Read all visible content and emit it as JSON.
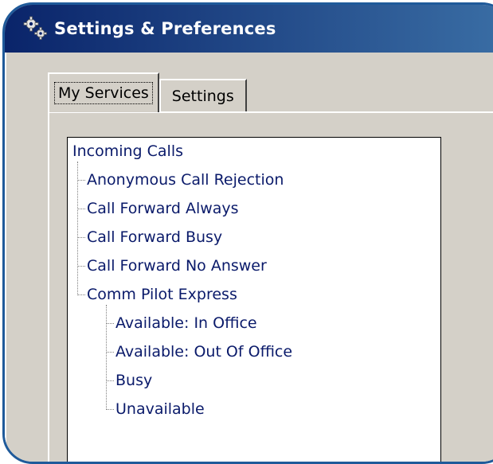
{
  "window": {
    "title": "Settings & Preferences",
    "icon": "gears-icon",
    "title_bar_color": "#0a246a",
    "frame_color": "#1f5a9a"
  },
  "tabs": [
    {
      "label": "My Services",
      "active": true
    },
    {
      "label": "Settings",
      "active": false
    }
  ],
  "tree": {
    "root": "Incoming Calls",
    "items": [
      {
        "label": "Anonymous Call Rejection",
        "level": 1
      },
      {
        "label": "Call Forward Always",
        "level": 1
      },
      {
        "label": "Call Forward Busy",
        "level": 1
      },
      {
        "label": "Call Forward No Answer",
        "level": 1
      },
      {
        "label": "Comm Pilot Express",
        "level": 1
      },
      {
        "label": "Available: In Office",
        "level": 2
      },
      {
        "label": "Available: Out Of Office",
        "level": 2
      },
      {
        "label": "Busy",
        "level": 2
      },
      {
        "label": "Unavailable",
        "level": 2
      }
    ]
  }
}
